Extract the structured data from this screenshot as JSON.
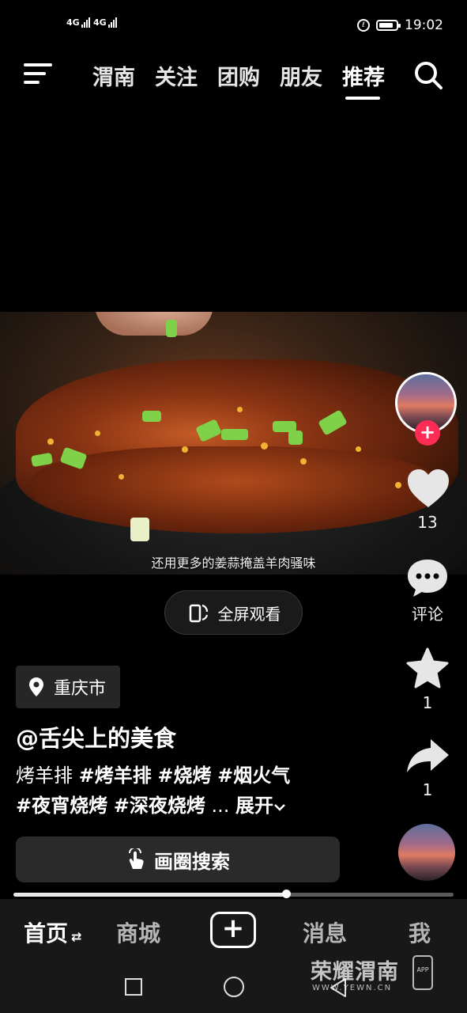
{
  "status_bar": {
    "signal_1": "4G",
    "signal_2": "4G",
    "time": "19:02"
  },
  "top_nav": {
    "tabs": [
      {
        "label": "渭南",
        "active": false
      },
      {
        "label": "关注",
        "active": false
      },
      {
        "label": "团购",
        "active": false
      },
      {
        "label": "朋友",
        "active": false
      },
      {
        "label": "推荐",
        "active": true
      }
    ]
  },
  "video": {
    "subtitle": "还用更多的姜蒜掩盖羊肉骚味",
    "fullscreen_label": "全屏观看",
    "progress_fraction": 0.62
  },
  "rail": {
    "like_count": "13",
    "comment_label": "评论",
    "favorite_count": "1",
    "share_count": "1"
  },
  "post": {
    "location": "重庆市",
    "author": "@舌尖上的美食",
    "desc_text": "烤羊排",
    "hashtags_line1": [
      "#烤羊排",
      "#烧烤",
      "#烟火气"
    ],
    "hashtags_line2": [
      "#夜宵烧烤",
      "#深夜烧烤"
    ],
    "ellipsis": "...",
    "expand_label": "展开"
  },
  "circle_search_label": "画圈搜索",
  "bottom_nav": {
    "home": "首页",
    "mall": "商城",
    "messages": "消息",
    "me": "我"
  },
  "watermark": {
    "title": "荣耀渭南",
    "url": "WWW.YEWN.CN",
    "app": "APP"
  },
  "colors": {
    "accent_red": "#fe2c55",
    "background": "#000000"
  }
}
